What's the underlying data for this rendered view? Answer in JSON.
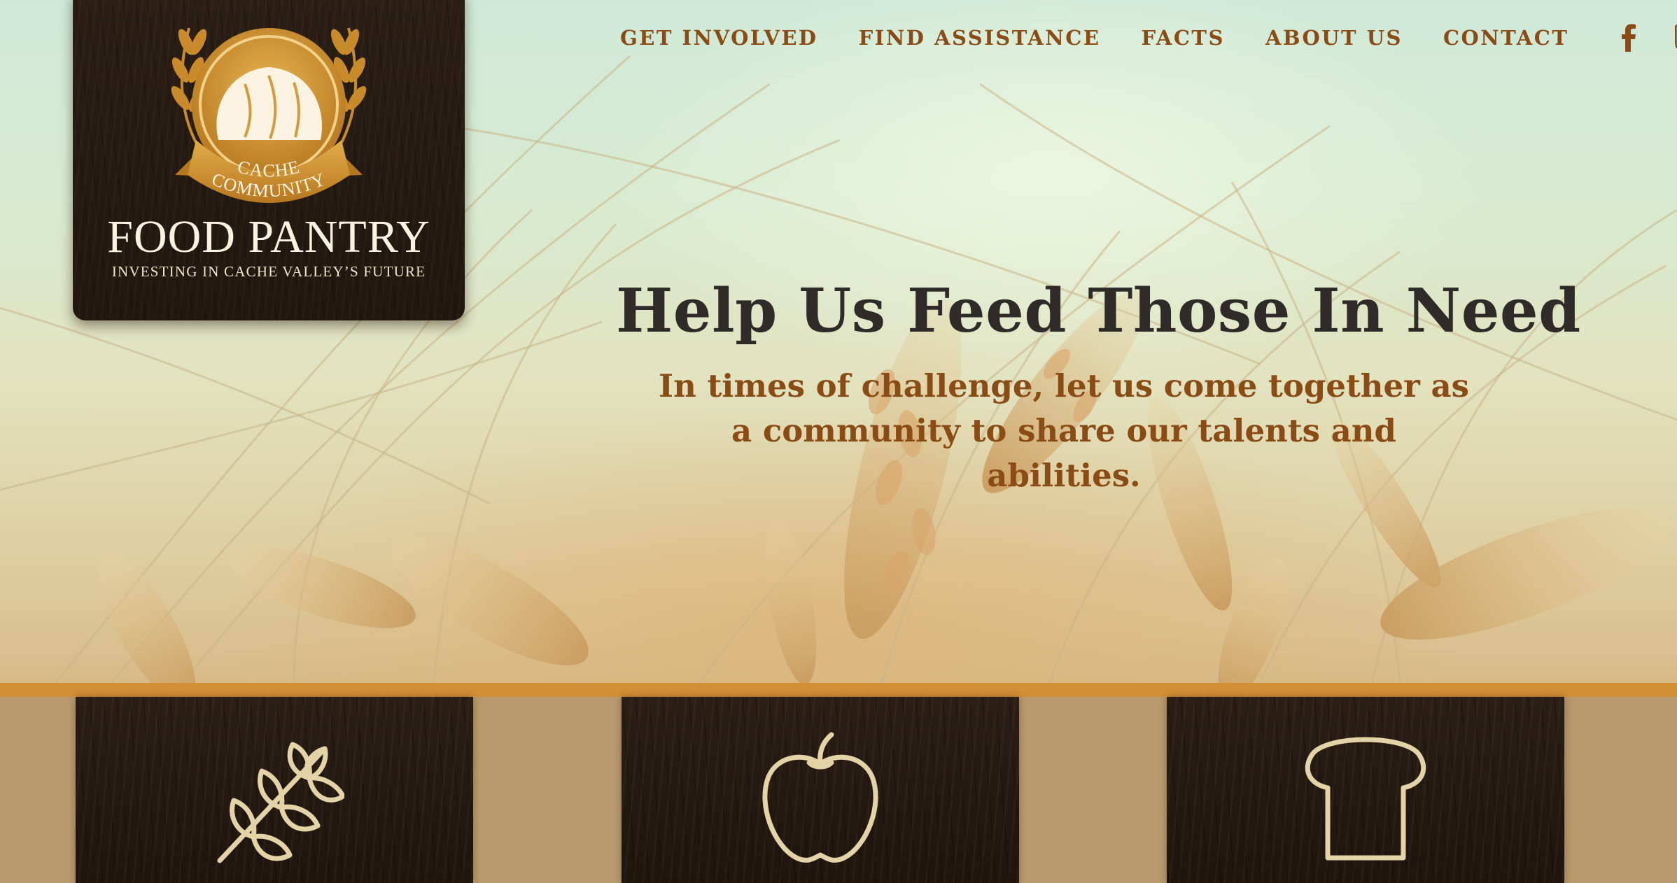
{
  "brand": {
    "ribbon_line1": "CACHE",
    "ribbon_line2": "COMMUNITY",
    "name": "FOOD PANTRY",
    "tagline": "INVESTING IN CACHE VALLEY’S FUTURE"
  },
  "nav": {
    "items": [
      {
        "label": "GET INVOLVED"
      },
      {
        "label": "FIND ASSISTANCE"
      },
      {
        "label": "FACTS"
      },
      {
        "label": "ABOUT US"
      },
      {
        "label": "CONTACT"
      }
    ],
    "social": [
      {
        "icon": "facebook-icon"
      },
      {
        "icon": "twitter-icon"
      }
    ]
  },
  "hero": {
    "headline": "Help Us Feed Those In Need",
    "subhead": "In times of challenge, let us come together as a community to share our talents and abilities."
  },
  "features": [
    {
      "icon": "wheat-icon"
    },
    {
      "icon": "apple-icon"
    },
    {
      "icon": "bread-icon"
    }
  ],
  "colors": {
    "accent": "#8a4b14",
    "stripe": "#d38f35",
    "card": "#24190f",
    "icon_stroke": "#e5d3a8",
    "band": "#b89a6c",
    "headline": "#2e2b28"
  }
}
